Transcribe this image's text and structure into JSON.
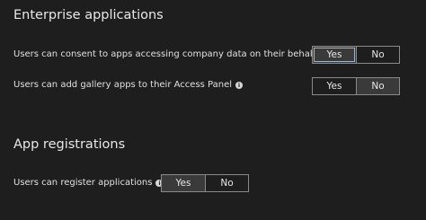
{
  "enterprise_apps": {
    "title": "Enterprise applications",
    "settings": [
      {
        "label": "Users can consent to apps accessing company data on their behalf",
        "info_icon": "i",
        "options": [
          "Yes",
          "No"
        ],
        "selected": "Yes"
      },
      {
        "label": "Users can add gallery apps to their Access Panel",
        "info_icon": "i",
        "options": [
          "Yes",
          "No"
        ],
        "selected": "No"
      }
    ]
  },
  "app_registrations": {
    "title": "App registrations",
    "settings": [
      {
        "label": "Users can register applications",
        "info_icon": "i",
        "options": [
          "Yes",
          "No"
        ],
        "selected": "Yes"
      }
    ]
  }
}
